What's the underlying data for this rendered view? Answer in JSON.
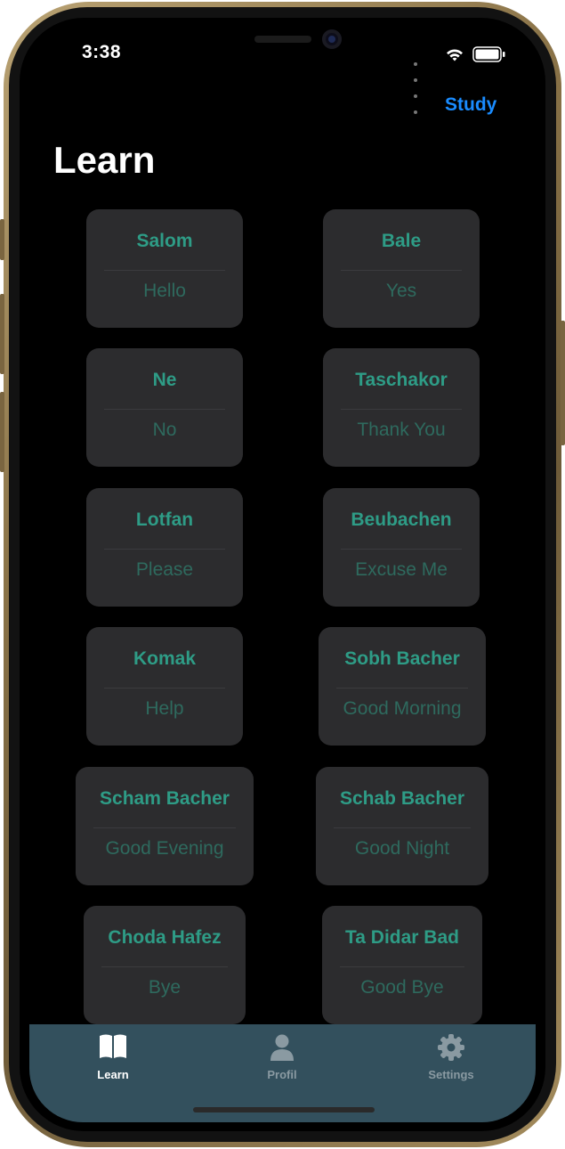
{
  "status_bar": {
    "time": "3:38",
    "icons": [
      "signal-dots-icon",
      "wifi-icon",
      "battery-icon"
    ]
  },
  "nav": {
    "action_label": "Study",
    "action_color": "#1a8cff"
  },
  "page": {
    "title": "Learn"
  },
  "colors": {
    "term": "#2e9c86",
    "meaning": "#2e6a5e",
    "card": "#2c2c2e",
    "tabbar": "#33505d",
    "tab_active": "#ffffff",
    "tab_inactive": "#8a9aa2"
  },
  "cards": [
    {
      "term": "Salom",
      "meaning": "Hello"
    },
    {
      "term": "Bale",
      "meaning": "Yes"
    },
    {
      "term": "Ne",
      "meaning": "No"
    },
    {
      "term": "Taschakor",
      "meaning": "Thank You"
    },
    {
      "term": "Lotfan",
      "meaning": "Please"
    },
    {
      "term": "Beubachen",
      "meaning": "Excuse Me"
    },
    {
      "term": "Komak",
      "meaning": "Help"
    },
    {
      "term": "Sobh Bacher",
      "meaning": "Good Morning"
    },
    {
      "term": "Scham Bacher",
      "meaning": "Good Evening"
    },
    {
      "term": "Schab Bacher",
      "meaning": "Good Night"
    },
    {
      "term": "Choda Hafez",
      "meaning": "Bye"
    },
    {
      "term": "Ta Didar Bad",
      "meaning": "Good Bye"
    }
  ],
  "tabbar": {
    "tabs": [
      {
        "label": "Learn",
        "icon": "book-icon",
        "active": true
      },
      {
        "label": "Profil",
        "icon": "person-icon",
        "active": false
      },
      {
        "label": "Settings",
        "icon": "gear-icon",
        "active": false
      }
    ]
  }
}
